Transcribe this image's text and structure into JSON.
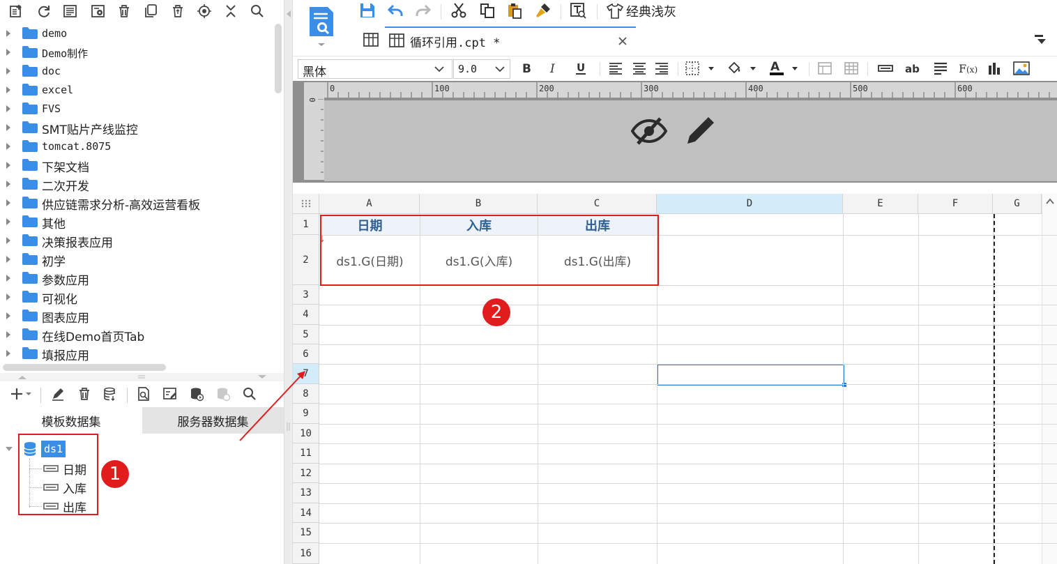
{
  "left_toolbar": {
    "icons": [
      "new-template-icon",
      "refresh-icon",
      "file-list-icon",
      "settings-icon",
      "delete-icon",
      "copy-icon",
      "recycle-icon",
      "locate-icon",
      "collapse-icon",
      "search-icon"
    ]
  },
  "file_tree": {
    "items": [
      {
        "label": "demo",
        "mono": true
      },
      {
        "label": "Demo制作",
        "mono": true
      },
      {
        "label": "doc",
        "mono": true
      },
      {
        "label": "excel",
        "mono": true
      },
      {
        "label": "FVS",
        "mono": true
      },
      {
        "label": "SMT贴片产线监控",
        "mono": false
      },
      {
        "label": "tomcat.8075",
        "mono": true
      },
      {
        "label": "下架文档",
        "mono": false
      },
      {
        "label": "二次开发",
        "mono": false
      },
      {
        "label": "供应链需求分析-高效运营看板",
        "mono": false
      },
      {
        "label": "其他",
        "mono": false
      },
      {
        "label": "决策报表应用",
        "mono": false
      },
      {
        "label": "初学",
        "mono": false
      },
      {
        "label": "参数应用",
        "mono": false
      },
      {
        "label": "可视化",
        "mono": false
      },
      {
        "label": "图表应用",
        "mono": false
      },
      {
        "label": "在线Demo首页Tab",
        "mono": false
      },
      {
        "label": "填报应用",
        "mono": false
      }
    ]
  },
  "dataset_panel": {
    "tabs": [
      "模板数据集",
      "服务器数据集"
    ],
    "active_tab": 0,
    "dataset_name": "ds1",
    "fields": [
      "日期",
      "入库",
      "出库"
    ]
  },
  "editor": {
    "tab_title": "循环引用.cpt *",
    "theme_label": "经典浅灰",
    "font_name": "黑体",
    "font_size": "9.0",
    "ruler_ticks": [
      "0",
      "100",
      "200",
      "300",
      "400",
      "500",
      "600"
    ],
    "vruler_tick": "0"
  },
  "sheet": {
    "columns": [
      "A",
      "B",
      "C",
      "D",
      "E",
      "F",
      "G"
    ],
    "rows": [
      "1",
      "2",
      "3",
      "4",
      "5",
      "6",
      "7",
      "8",
      "9",
      "10",
      "11",
      "12",
      "13",
      "14",
      "15",
      "16"
    ],
    "header_cells": [
      "日期",
      "入库",
      "出库"
    ],
    "formula_cells": [
      "ds1.G(日期)",
      "ds1.G(入库)",
      "ds1.G(出库)"
    ]
  },
  "annotations": {
    "badge_1": "1",
    "badge_2": "2"
  },
  "colors": {
    "accent": "#2d7bd6",
    "annotation_red": "#e01d1d",
    "header_text": "#2f5f91",
    "selected_column": "#d3ecf9"
  }
}
